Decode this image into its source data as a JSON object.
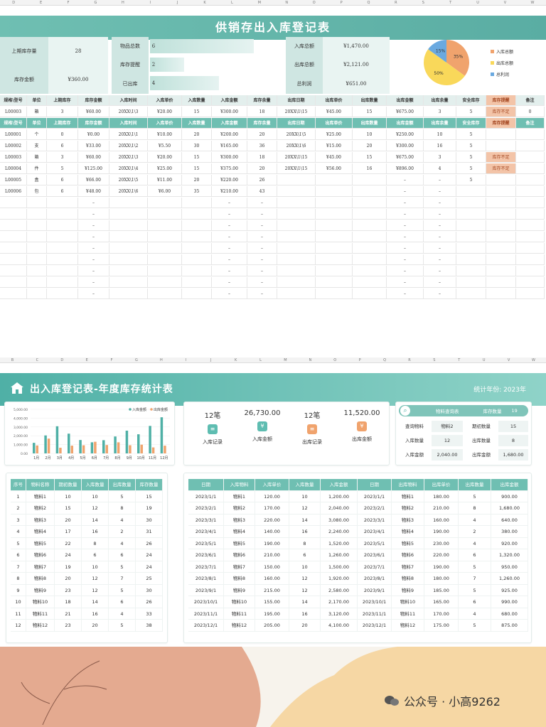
{
  "top_col_letters": [
    "D",
    "E",
    "F",
    "G",
    "H",
    "I",
    "J",
    "K",
    "L",
    "M",
    "N",
    "O",
    "P",
    "Q",
    "R",
    "S",
    "T",
    "U",
    "V",
    "W"
  ],
  "bottom_col_letters": [
    "B",
    "C",
    "D",
    "E",
    "F",
    "G",
    "H",
    "I",
    "J",
    "K",
    "L",
    "M",
    "N",
    "O",
    "P",
    "Q",
    "R",
    "S",
    "T",
    "U",
    "V",
    "W"
  ],
  "sheet1": {
    "title": "供销存出入库登记表",
    "summary": {
      "last_stock_label": "上期库存量",
      "last_stock_value": "28",
      "stock_amount_label": "库存金额",
      "stock_amount_value": "¥360.00",
      "item_total_label": "物品总数",
      "item_total_value": "6",
      "alert_label": "库存提醒",
      "alert_value": "2",
      "out_label": "已出库",
      "out_value": "4",
      "in_total_label": "入库总额",
      "in_total_value": "¥1,470.00",
      "out_total_label": "出库总额",
      "out_total_value": "¥2,121.00",
      "profit_label": "总利润",
      "profit_value": "¥651.00"
    },
    "pie": {
      "legend": [
        "入库总额",
        "出库总额",
        "总利润"
      ],
      "colors": [
        "#f0a36d",
        "#f9d85a",
        "#6aa9e0"
      ],
      "values": [
        35,
        50,
        15
      ],
      "labels": [
        "35%",
        "50%",
        "15%"
      ]
    },
    "header_row": [
      "规格\\型号",
      "单位",
      "上期库存",
      "库存金额",
      "入库时间",
      "入库单价",
      "入库数量",
      "入库金额",
      "库存余量",
      "出库日期",
      "出库单价",
      "出库数量",
      "出库金额",
      "出库余量",
      "安全库存",
      "库存提醒",
      "备注"
    ],
    "first_row": [
      "L00003",
      "箱",
      "3",
      "¥60.00",
      "20XX\\1\\3",
      "¥20.00",
      "15",
      "¥300.00",
      "18",
      "20XX\\1\\15",
      "¥45.00",
      "15",
      "¥675.00",
      "3",
      "5",
      "库存不足",
      "0"
    ],
    "rows": [
      [
        "L00001",
        "个",
        "0",
        "¥0.00",
        "20XX\\1\\1",
        "¥10.00",
        "20",
        "¥200.00",
        "20",
        "20XX\\1\\5",
        "¥25.00",
        "10",
        "¥250.00",
        "10",
        "5",
        "",
        ""
      ],
      [
        "L00002",
        "支",
        "6",
        "¥33.00",
        "20XX\\1\\2",
        "¥5.50",
        "30",
        "¥165.00",
        "36",
        "20XX\\1\\6",
        "¥15.00",
        "20",
        "¥300.00",
        "16",
        "5",
        "",
        ""
      ],
      [
        "L00003",
        "箱",
        "3",
        "¥60.00",
        "20XX\\1\\3",
        "¥20.00",
        "15",
        "¥300.00",
        "18",
        "20XX\\1\\15",
        "¥45.00",
        "15",
        "¥675.00",
        "3",
        "5",
        "库存不足",
        ""
      ],
      [
        "L00004",
        "件",
        "5",
        "¥125.00",
        "20XX\\1\\4",
        "¥25.00",
        "15",
        "¥375.00",
        "20",
        "20XX\\1\\15",
        "¥56.00",
        "16",
        "¥896.00",
        "4",
        "5",
        "库存不足",
        ""
      ],
      [
        "L00005",
        "盒",
        "6",
        "¥66.00",
        "20XX\\1\\5",
        "¥11.00",
        "20",
        "¥220.00",
        "26",
        "",
        "",
        "",
        "–",
        "–",
        "5",
        "",
        ""
      ],
      [
        "L00006",
        "包",
        "6",
        "¥48.00",
        "20XX\\1\\6",
        "¥6.00",
        "35",
        "¥210.00",
        "43",
        "",
        "",
        "",
        "–",
        "–",
        "",
        "",
        ""
      ]
    ],
    "dash": "–"
  },
  "sheet2": {
    "title": "出入库登记表-年度库存统计表",
    "year_label": "统计年份: 2023年",
    "chart_data": {
      "type": "bar",
      "categories": [
        "1月",
        "2月",
        "3月",
        "4月",
        "5月",
        "6月",
        "7月",
        "8月",
        "9月",
        "10月",
        "11月",
        "12月"
      ],
      "series": [
        {
          "name": "入库金额",
          "color": "#4fb0a6",
          "values": [
            1200,
            2040,
            3080,
            2240,
            1520,
            1260,
            1500,
            1920,
            2580,
            2170,
            3120,
            4100
          ]
        },
        {
          "name": "出库金额",
          "color": "#f0a36d",
          "values": [
            900,
            1680,
            640,
            880,
            920,
            1320,
            950,
            1260,
            925,
            990,
            680,
            875
          ]
        }
      ],
      "yticks": [
        "5,000.00",
        "4,000.00",
        "3,000.00",
        "2,000.00",
        "1,000.00",
        "0.00"
      ],
      "ylim": [
        0,
        5000
      ]
    },
    "kpis": [
      {
        "value": "12笔",
        "label": "入库记录",
        "icon": "clipboard-icon",
        "color": "#5ebdb1"
      },
      {
        "value": "26,730.00",
        "label": "入库金额",
        "icon": "yen-icon",
        "color": "#5ebdb1"
      },
      {
        "value": "12笔",
        "label": "出库记录",
        "icon": "clipboard-icon",
        "color": "#f0a36d"
      },
      {
        "value": "11,520.00",
        "label": "出库金额",
        "icon": "yen-icon",
        "color": "#f0a36d"
      }
    ],
    "query": {
      "title": "物料查询表",
      "count_label": "库存数量",
      "count_value": "19",
      "rows": [
        [
          "查询物料",
          "物料2",
          "期初数量",
          "15"
        ],
        [
          "入库数量",
          "12",
          "出库数量",
          "8"
        ],
        [
          "入库金额",
          "2,040.00",
          "出库金额",
          "1,680.00"
        ]
      ]
    },
    "left_table": {
      "headers": [
        "序号",
        "物料名称",
        "期初数量",
        "入库数量",
        "出库数量",
        "库存数量"
      ],
      "rows": [
        [
          "1",
          "物料1",
          "10",
          "10",
          "5",
          "15"
        ],
        [
          "2",
          "物料2",
          "15",
          "12",
          "8",
          "19"
        ],
        [
          "3",
          "物料3",
          "20",
          "14",
          "4",
          "30"
        ],
        [
          "4",
          "物料4",
          "17",
          "16",
          "2",
          "31"
        ],
        [
          "5",
          "物料5",
          "22",
          "8",
          "4",
          "26"
        ],
        [
          "6",
          "物料6",
          "24",
          "6",
          "6",
          "24"
        ],
        [
          "7",
          "物料7",
          "19",
          "10",
          "5",
          "24"
        ],
        [
          "8",
          "物料8",
          "20",
          "12",
          "7",
          "25"
        ],
        [
          "9",
          "物料9",
          "23",
          "12",
          "5",
          "30"
        ],
        [
          "10",
          "物料10",
          "18",
          "14",
          "6",
          "26"
        ],
        [
          "11",
          "物料11",
          "21",
          "16",
          "4",
          "33"
        ],
        [
          "12",
          "物料12",
          "23",
          "20",
          "5",
          "38"
        ]
      ]
    },
    "right_table": {
      "headers": [
        "日期",
        "入库物料",
        "入库单价",
        "入库数量",
        "入库金额",
        "日期",
        "出库物料",
        "出库单价",
        "出库数量",
        "出库金额"
      ],
      "rows": [
        [
          "2023/1/1",
          "物料1",
          "120.00",
          "10",
          "1,200.00",
          "2023/1/1",
          "物料1",
          "180.00",
          "5",
          "900.00"
        ],
        [
          "2023/2/1",
          "物料2",
          "170.00",
          "12",
          "2,040.00",
          "2023/2/1",
          "物料2",
          "210.00",
          "8",
          "1,680.00"
        ],
        [
          "2023/3/1",
          "物料3",
          "220.00",
          "14",
          "3,080.00",
          "2023/3/1",
          "物料3",
          "160.00",
          "4",
          "640.00"
        ],
        [
          "2023/4/1",
          "物料4",
          "140.00",
          "16",
          "2,240.00",
          "2023/4/1",
          "物料4",
          "190.00",
          "2",
          "380.00"
        ],
        [
          "2023/5/1",
          "物料5",
          "190.00",
          "8",
          "1,520.00",
          "2023/5/1",
          "物料5",
          "230.00",
          "4",
          "920.00"
        ],
        [
          "2023/6/1",
          "物料6",
          "210.00",
          "6",
          "1,260.00",
          "2023/6/1",
          "物料6",
          "220.00",
          "6",
          "1,320.00"
        ],
        [
          "2023/7/1",
          "物料7",
          "150.00",
          "10",
          "1,500.00",
          "2023/7/1",
          "物料7",
          "190.00",
          "5",
          "950.00"
        ],
        [
          "2023/8/1",
          "物料8",
          "160.00",
          "12",
          "1,920.00",
          "2023/8/1",
          "物料8",
          "180.00",
          "7",
          "1,260.00"
        ],
        [
          "2023/9/1",
          "物料9",
          "215.00",
          "12",
          "2,580.00",
          "2023/9/1",
          "物料9",
          "185.00",
          "5",
          "925.00"
        ],
        [
          "2023/10/1",
          "物料10",
          "155.00",
          "14",
          "2,170.00",
          "2023/10/1",
          "物料10",
          "165.00",
          "6",
          "990.00"
        ],
        [
          "2023/11/1",
          "物料11",
          "195.00",
          "16",
          "3,120.00",
          "2023/11/1",
          "物料11",
          "170.00",
          "4",
          "680.00"
        ],
        [
          "2023/12/1",
          "物料12",
          "205.00",
          "20",
          "4,100.00",
          "2023/12/1",
          "物料12",
          "175.00",
          "5",
          "875.00"
        ]
      ]
    }
  },
  "watermark": "公众号 · 小高9262"
}
